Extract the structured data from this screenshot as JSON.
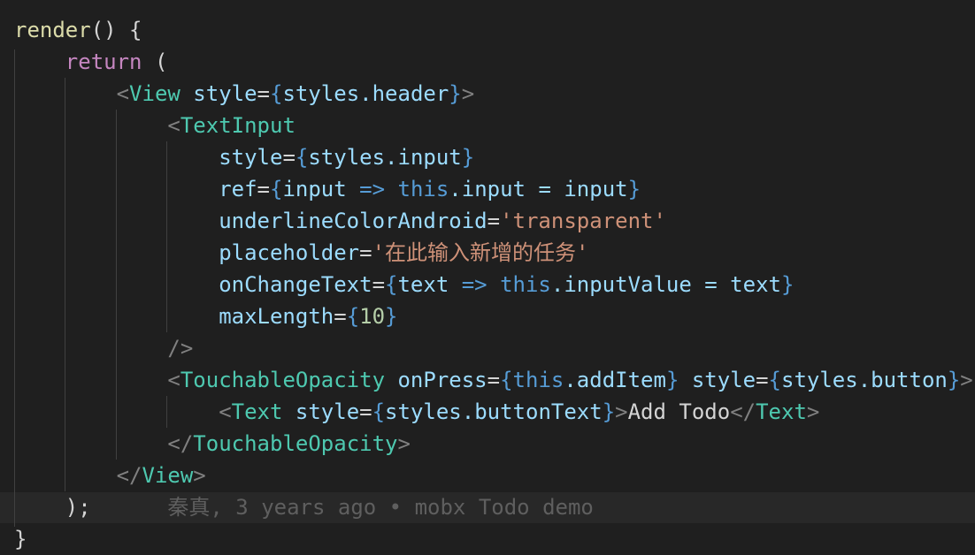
{
  "editor": {
    "lines": [
      [
        {
          "t": "render",
          "c": "k-func"
        },
        {
          "t": "() {",
          "c": "k-text"
        }
      ],
      [
        {
          "t": "    ",
          "c": "k-text"
        },
        {
          "t": "return",
          "c": "k-keyword"
        },
        {
          "t": " (",
          "c": "k-text"
        }
      ],
      [
        {
          "t": "        ",
          "c": "k-text"
        },
        {
          "t": "<",
          "c": "k-punc"
        },
        {
          "t": "View",
          "c": "k-tag"
        },
        {
          "t": " ",
          "c": "k-text"
        },
        {
          "t": "style",
          "c": "k-attr"
        },
        {
          "t": "=",
          "c": "k-text"
        },
        {
          "t": "{",
          "c": "k-brace"
        },
        {
          "t": "styles.header",
          "c": "k-var"
        },
        {
          "t": "}",
          "c": "k-brace"
        },
        {
          "t": ">",
          "c": "k-punc"
        }
      ],
      [
        {
          "t": "            ",
          "c": "k-text"
        },
        {
          "t": "<",
          "c": "k-punc"
        },
        {
          "t": "TextInput",
          "c": "k-tag"
        }
      ],
      [
        {
          "t": "                ",
          "c": "k-text"
        },
        {
          "t": "style",
          "c": "k-attr"
        },
        {
          "t": "=",
          "c": "k-text"
        },
        {
          "t": "{",
          "c": "k-brace"
        },
        {
          "t": "styles.input",
          "c": "k-var"
        },
        {
          "t": "}",
          "c": "k-brace"
        }
      ],
      [
        {
          "t": "                ",
          "c": "k-text"
        },
        {
          "t": "ref",
          "c": "k-attr"
        },
        {
          "t": "=",
          "c": "k-text"
        },
        {
          "t": "{",
          "c": "k-brace"
        },
        {
          "t": "input",
          "c": "k-var"
        },
        {
          "t": " => ",
          "c": "k-brace"
        },
        {
          "t": "this",
          "c": "k-this"
        },
        {
          "t": ".input = input",
          "c": "k-var"
        },
        {
          "t": "}",
          "c": "k-brace"
        }
      ],
      [
        {
          "t": "                ",
          "c": "k-text"
        },
        {
          "t": "underlineColorAndroid",
          "c": "k-attr"
        },
        {
          "t": "=",
          "c": "k-text"
        },
        {
          "t": "'transparent'",
          "c": "k-string"
        }
      ],
      [
        {
          "t": "                ",
          "c": "k-text"
        },
        {
          "t": "placeholder",
          "c": "k-attr"
        },
        {
          "t": "=",
          "c": "k-text"
        },
        {
          "t": "'在此输入新增的任务'",
          "c": "k-string"
        }
      ],
      [
        {
          "t": "                ",
          "c": "k-text"
        },
        {
          "t": "onChangeText",
          "c": "k-attr"
        },
        {
          "t": "=",
          "c": "k-text"
        },
        {
          "t": "{",
          "c": "k-brace"
        },
        {
          "t": "text",
          "c": "k-var"
        },
        {
          "t": " => ",
          "c": "k-brace"
        },
        {
          "t": "this",
          "c": "k-this"
        },
        {
          "t": ".inputValue = text",
          "c": "k-var"
        },
        {
          "t": "}",
          "c": "k-brace"
        }
      ],
      [
        {
          "t": "                ",
          "c": "k-text"
        },
        {
          "t": "maxLength",
          "c": "k-attr"
        },
        {
          "t": "=",
          "c": "k-text"
        },
        {
          "t": "{",
          "c": "k-brace"
        },
        {
          "t": "10",
          "c": "k-number"
        },
        {
          "t": "}",
          "c": "k-brace"
        }
      ],
      [
        {
          "t": "            ",
          "c": "k-text"
        },
        {
          "t": "/>",
          "c": "k-punc"
        }
      ],
      [
        {
          "t": "            ",
          "c": "k-text"
        },
        {
          "t": "<",
          "c": "k-punc"
        },
        {
          "t": "TouchableOpacity",
          "c": "k-tag"
        },
        {
          "t": " ",
          "c": "k-text"
        },
        {
          "t": "onPress",
          "c": "k-attr"
        },
        {
          "t": "=",
          "c": "k-text"
        },
        {
          "t": "{",
          "c": "k-brace"
        },
        {
          "t": "this",
          "c": "k-this"
        },
        {
          "t": ".addItem",
          "c": "k-var"
        },
        {
          "t": "}",
          "c": "k-brace"
        },
        {
          "t": " ",
          "c": "k-text"
        },
        {
          "t": "style",
          "c": "k-attr"
        },
        {
          "t": "=",
          "c": "k-text"
        },
        {
          "t": "{",
          "c": "k-brace"
        },
        {
          "t": "styles.button",
          "c": "k-var"
        },
        {
          "t": "}",
          "c": "k-brace"
        },
        {
          "t": ">",
          "c": "k-punc"
        }
      ],
      [
        {
          "t": "                ",
          "c": "k-text"
        },
        {
          "t": "<",
          "c": "k-punc"
        },
        {
          "t": "Text",
          "c": "k-tag"
        },
        {
          "t": " ",
          "c": "k-text"
        },
        {
          "t": "style",
          "c": "k-attr"
        },
        {
          "t": "=",
          "c": "k-text"
        },
        {
          "t": "{",
          "c": "k-brace"
        },
        {
          "t": "styles.buttonText",
          "c": "k-var"
        },
        {
          "t": "}",
          "c": "k-brace"
        },
        {
          "t": ">",
          "c": "k-punc"
        },
        {
          "t": "Add Todo",
          "c": "k-text"
        },
        {
          "t": "</",
          "c": "k-punc"
        },
        {
          "t": "Text",
          "c": "k-tag"
        },
        {
          "t": ">",
          "c": "k-punc"
        }
      ],
      [
        {
          "t": "            ",
          "c": "k-text"
        },
        {
          "t": "</",
          "c": "k-punc"
        },
        {
          "t": "TouchableOpacity",
          "c": "k-tag"
        },
        {
          "t": ">",
          "c": "k-punc"
        }
      ],
      [
        {
          "t": "        ",
          "c": "k-text"
        },
        {
          "t": "</",
          "c": "k-punc"
        },
        {
          "t": "View",
          "c": "k-tag"
        },
        {
          "t": ">",
          "c": "k-punc"
        }
      ],
      [
        {
          "t": "    );",
          "c": "k-text"
        }
      ],
      [
        {
          "t": "}",
          "c": "k-text"
        }
      ]
    ],
    "blame": "秦真, 3 years ago • mobx Todo demo"
  }
}
